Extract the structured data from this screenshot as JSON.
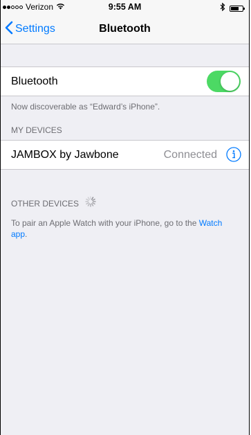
{
  "status_bar": {
    "signal_bars_filled": 2,
    "signal_bars_total": 5,
    "carrier": "Verizon",
    "wifi_icon": "wifi-icon",
    "time": "9:55 AM",
    "bluetooth_icon": "bluetooth-icon",
    "battery_icon": "battery-icon",
    "battery_level": 0.7
  },
  "nav": {
    "back_label": "Settings",
    "back_icon": "chevron-left-icon",
    "title": "Bluetooth"
  },
  "bluetooth_toggle": {
    "label": "Bluetooth",
    "on": true,
    "on_color": "#4cd964"
  },
  "discoverable_text": "Now discoverable as “Edward’s iPhone”.",
  "my_devices": {
    "header": "MY DEVICES",
    "devices": [
      {
        "name": "JAMBOX by Jawbone",
        "status": "Connected",
        "info_icon": "info-icon"
      }
    ]
  },
  "other_devices": {
    "header": "OTHER DEVICES",
    "spinner_icon": "spinner-icon",
    "hint_prefix": "To pair an Apple Watch with your iPhone, go to the",
    "hint_link": "Watch app",
    "hint_suffix": "."
  },
  "colors": {
    "accent": "#007aff",
    "background": "#efeff4",
    "secondary_text": "#6d6d72",
    "detail_text": "#8e8e93"
  }
}
